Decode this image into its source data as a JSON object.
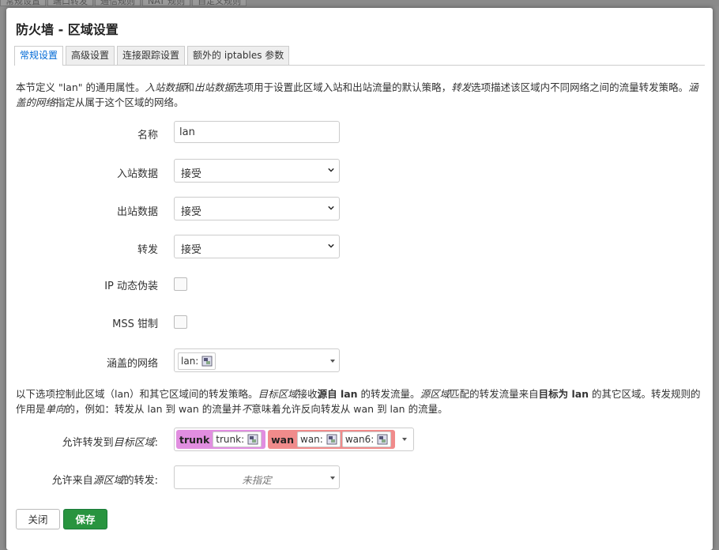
{
  "background": {
    "tabs": [
      "常规设置",
      "端口转发",
      "通信规则",
      "NAT 规则",
      "自定义规则"
    ]
  },
  "modal": {
    "title": "防火墙 - 区域设置",
    "tabs": [
      {
        "label": "常规设置",
        "active": true
      },
      {
        "label": "高级设置",
        "active": false
      },
      {
        "label": "连接跟踪设置",
        "active": false
      },
      {
        "label": "额外的 iptables 参数",
        "active": false
      }
    ],
    "description": {
      "p1": "本节定义 \"lan\" 的通用属性。",
      "i1": "入站数据",
      "p2": "和",
      "i2": "出站数据",
      "p3": "选项用于设置此区域入站和出站流量的默认策略，",
      "i3": "转发",
      "p4": "选项描述该区域内不同网络之间的流量转发策略。",
      "i4": "涵盖的网络",
      "p5": "指定从属于这个区域的网络。"
    },
    "fields": {
      "name": {
        "label": "名称",
        "value": "lan"
      },
      "input": {
        "label": "入站数据",
        "value": "接受"
      },
      "output": {
        "label": "出站数据",
        "value": "接受"
      },
      "forward": {
        "label": "转发",
        "value": "接受"
      },
      "masq": {
        "label": "IP 动态伪装",
        "checked": false
      },
      "mss": {
        "label": "MSS 钳制",
        "checked": false
      },
      "networks": {
        "label": "涵盖的网络",
        "items": [
          "lan:"
        ]
      }
    },
    "forward_description": {
      "p1": "以下选项控制此区域（lan）和其它区域间的转发策略。",
      "i1": "目标区域",
      "p2": "接收",
      "b1": "源自 lan",
      "p3": " 的转发流量。",
      "i2": "源区域",
      "p4": "匹配的转发流量来自",
      "b2": "目标为 lan",
      "p5": " 的其它区域。转发规则的作用是",
      "i3": "单向",
      "p6": "的，例如：转发从 lan 到 wan 的流量并",
      "i4": "不",
      "p7": "意味着允许反向转发从 wan 到 lan 的流量。"
    },
    "forward_dest": {
      "label_pre": "允许转发到",
      "label_em": "目标区域",
      "label_post": ":",
      "zones": [
        {
          "name": "trunk",
          "color": "#e18ee0",
          "nets": [
            "trunk:"
          ]
        },
        {
          "name": "wan",
          "color": "#f08b8b",
          "nets": [
            "wan:",
            "wan6:"
          ]
        }
      ]
    },
    "forward_src": {
      "label_pre": "允许来自",
      "label_em": "源区域",
      "label_post": "的转发:",
      "value": "未指定"
    },
    "buttons": {
      "close": "关闭",
      "save": "保存"
    }
  },
  "colors": {
    "accent": "#0069d6",
    "save": "#28943f"
  }
}
